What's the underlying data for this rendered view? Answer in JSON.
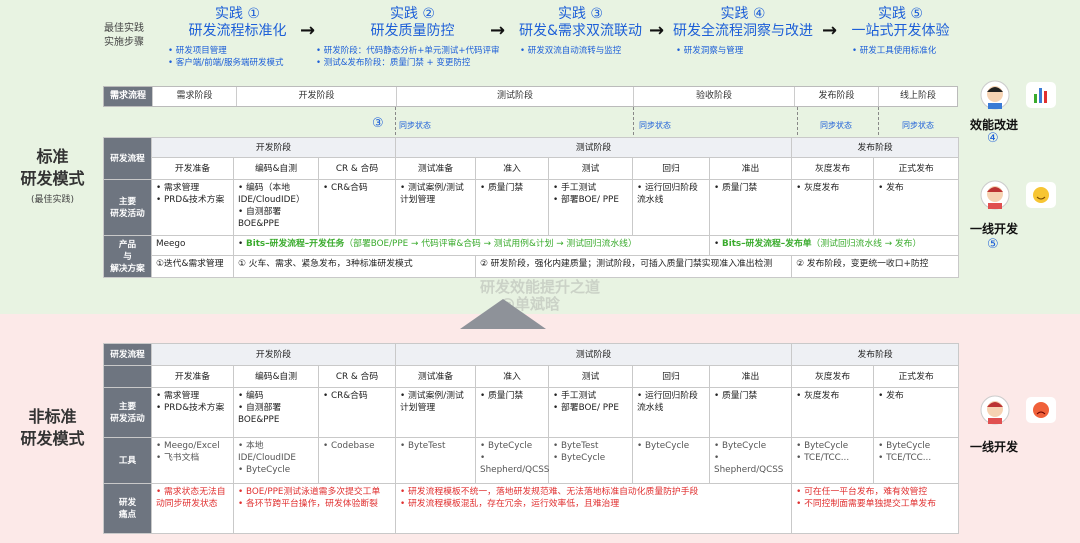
{
  "steps_label": [
    "最佳实践",
    "实施步骤"
  ],
  "steps": [
    {
      "num": "实践 ①",
      "title": "研发流程标准化",
      "bullets": [
        "研发项目管理",
        "客户端/前端/服务端研发模式"
      ]
    },
    {
      "num": "实践 ②",
      "title": "研发质量防控",
      "bullets": [
        "研发阶段：代码静态分析+单元测试+代码评审",
        "测试&发布阶段：质量门禁 + 变更防控"
      ]
    },
    {
      "num": "实践 ③",
      "title": "研发&需求双流联动",
      "bullets": [
        "研发双流自动流转与监控"
      ]
    },
    {
      "num": "实践 ④",
      "title": "研发全流程洞察与改进",
      "bullets": [
        "研发洞察与管理"
      ]
    },
    {
      "num": "实践 ⑤",
      "title": "一站式开发体验",
      "bullets": [
        "研发工具使用标准化"
      ]
    }
  ],
  "demand_strip": {
    "header": "需求流程",
    "cells": [
      "需求阶段",
      "开发阶段",
      "测试阶段",
      "验收阶段",
      "发布阶段",
      "线上阶段"
    ]
  },
  "sync_label": "同步状态",
  "circle3": "③",
  "standard": {
    "title": [
      "标准",
      "研发模式"
    ],
    "subtitle": "(最佳实践)",
    "phases": [
      "开发阶段",
      "测试阶段",
      "发布阶段"
    ],
    "header": "研发流程",
    "subphases": [
      "开发准备",
      "编码&自测",
      "CR & 合码",
      "测试准备",
      "准入",
      "测试",
      "回归",
      "准出",
      "灰度发布",
      "正式发布"
    ],
    "activities_header": "主要\n研发活动",
    "activities": [
      [
        "需求管理",
        "PRD&技术方案"
      ],
      [
        "编码（本地IDE/CloudIDE）",
        "自测部署BOE&PPE"
      ],
      [
        "CR&合码"
      ],
      [
        "测试案例/测试计划管理"
      ],
      [
        "质量门禁"
      ],
      [
        "手工测试",
        "部署BOE/ PPE"
      ],
      [
        "运行回归阶段流水线"
      ],
      [
        "质量门禁"
      ],
      [
        "灰度发布"
      ],
      [
        "发布"
      ]
    ],
    "product_header": "产品\n与\n解决方案",
    "product_row1": {
      "a": "Meego",
      "b": "Bits–研发流程–开发任务",
      "b2": "（部署BOE/PPE → 代码评审&合码 → 测试用例&计划 → 测试回归流水线）",
      "c": "Bits–研发流程–发布单",
      "c2": "（测试回归流水线 → 发布）"
    },
    "product_row2": {
      "a": "①迭代&需求管理",
      "b": "① 火车、需求、紧急发布，3种标准研发模式",
      "c": "② 研发阶段，强化内建质量；测试阶段，可插入质量门禁实现准入准出检测",
      "d": "② 发布阶段，变更统一收口+防控"
    }
  },
  "nonstandard": {
    "title": [
      "非标准",
      "研发模式"
    ],
    "header": "研发流程",
    "phases": [
      "开发阶段",
      "测试阶段",
      "发布阶段"
    ],
    "subphases": [
      "开发准备",
      "编码&自测",
      "CR & 合码",
      "测试准备",
      "准入",
      "测试",
      "回归",
      "准出",
      "灰度发布",
      "正式发布"
    ],
    "activities_header": "主要\n研发活动",
    "activities": [
      [
        "需求管理",
        "PRD&技术方案"
      ],
      [
        "编码",
        "自测部署BOE&PPE"
      ],
      [
        "CR&合码"
      ],
      [
        "测试案例/测试计划管理"
      ],
      [
        "质量门禁"
      ],
      [
        "手工测试",
        "部署BOE/ PPE"
      ],
      [
        "运行回归阶段流水线"
      ],
      [
        "质量门禁"
      ],
      [
        "灰度发布"
      ],
      [
        "发布"
      ]
    ],
    "tools_header": "工具",
    "tools": [
      [
        "Meego/Excel",
        "飞书文档"
      ],
      [
        "本地IDE/CloudIDE",
        "ByteCycle"
      ],
      [
        "Codebase"
      ],
      [
        "ByteTest"
      ],
      [
        "ByteCycle",
        "Shepherd/QCSS"
      ],
      [
        "ByteTest",
        "ByteCycle"
      ],
      [
        "ByteCycle"
      ],
      [
        "ByteCycle",
        "Shepherd/QCSS"
      ],
      [
        "ByteCycle",
        "TCE/TCC..."
      ],
      [
        "ByteCycle",
        "TCE/TCC..."
      ]
    ],
    "pain_header": "研发\n痛点",
    "pain_dev": [
      "需求状态无法自动同步研发状态",
      "BOE/PPE测试泳道需多次提交工单",
      "各环节跨平台操作，研发体验断裂"
    ],
    "pain_test": [
      "研发流程模板不统一，落地研发规范难、无法落地标准自动化质量防护手段",
      "研发流程模板混乱，存在冗余，运行效率低，且难治理"
    ],
    "pain_release": [
      "可在任一平台发布，难有效管控",
      "不同控制面需要单独提交工单发布"
    ]
  },
  "right": {
    "efficiency": "效能改进",
    "circle4": "④",
    "frontline": "一线开发",
    "circle5": "⑤",
    "frontline2": "一线开发"
  },
  "watermark": [
    "研发效能提升之道",
    "@单斌晗"
  ],
  "colors": {
    "blue": "#1d5fd8",
    "green": "#3aab2d",
    "red": "#e03030",
    "header": "#6e7580"
  }
}
